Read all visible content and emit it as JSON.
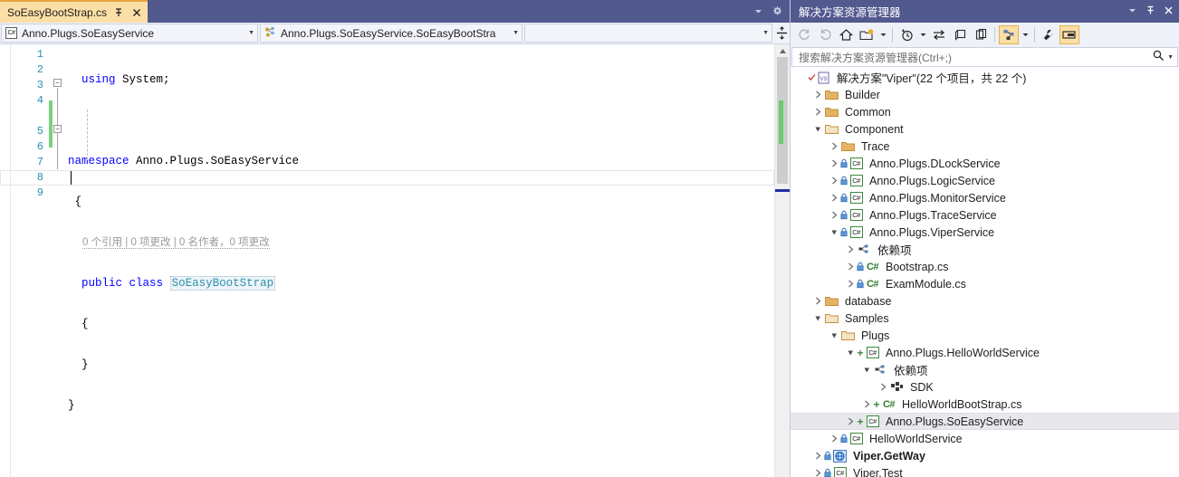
{
  "editor": {
    "tab": {
      "title": "SoEasyBootStrap.cs",
      "pin_icon": "pin-icon",
      "close_icon": "close-icon"
    },
    "tabstrip_right": {
      "dropdown_icon": "chevron-down-icon",
      "settings_icon": "gear-icon"
    },
    "navbar": {
      "project_combo": {
        "icon": "csharp-project-icon",
        "value": "Anno.Plugs.SoEasyService",
        "arrow": "chevron-down-icon"
      },
      "type_combo": {
        "icon": "class-members-icon",
        "value": "Anno.Plugs.SoEasyService.SoEasyBootStra",
        "arrow": "chevron-down-icon"
      },
      "member_combo": {
        "value": "",
        "arrow": "chevron-down-icon"
      },
      "split_icon": "split-view-icon"
    },
    "line_numbers": [
      "1",
      "2",
      "3",
      "4",
      "5",
      "6",
      "7",
      "8",
      "9"
    ],
    "codelens": "0 个引用 | 0 项更改 | 0 名作者，0 项更改",
    "code": {
      "l1_kw": "using",
      "l1_rest": " System;",
      "l3_kw": "namespace",
      "l3_rest": " Anno.Plugs.SoEasyService",
      "l4": "{",
      "l5_kw1": "public",
      "l5_kw2": "class",
      "l5_type": "SoEasyBootStrap",
      "l6": "{",
      "l7": "}",
      "l8": "}"
    },
    "scrollbar": {
      "up_icon": "scroll-up-icon",
      "down_icon": "scroll-down-icon"
    }
  },
  "solution_explorer": {
    "title": "解决方案资源管理器",
    "title_buttons": {
      "dropdown_icon": "chevron-down-icon",
      "pin_icon": "pin-icon",
      "close_icon": "close-icon"
    },
    "toolbar": [
      {
        "name": "back-button",
        "icon": "arrow-back-icon",
        "disabled": true,
        "active": false
      },
      {
        "name": "forward-button",
        "icon": "arrow-forward-icon",
        "disabled": true,
        "active": false
      },
      {
        "name": "home-button",
        "icon": "home-icon",
        "disabled": false,
        "active": false
      },
      {
        "name": "new-folder-button",
        "icon": "new-folder-icon",
        "disabled": false,
        "active": false
      },
      {
        "name": "new-folder-dropdown",
        "icon": "chevron-down-icon",
        "disabled": false,
        "active": false,
        "small": true
      },
      {
        "name": "pending-changes-button",
        "icon": "clock-icon",
        "disabled": false,
        "active": false
      },
      {
        "name": "pending-changes-dropdown",
        "icon": "chevron-down-icon",
        "disabled": false,
        "active": false,
        "small": true
      },
      {
        "name": "sync-with-active-document-button",
        "icon": "sync-arrows-icon",
        "disabled": false,
        "active": false
      },
      {
        "name": "refresh-button",
        "icon": "refresh-windows-icon",
        "disabled": false,
        "active": false
      },
      {
        "name": "collapse-all-button",
        "icon": "collapse-all-icon",
        "disabled": false,
        "active": false
      },
      {
        "name": "show-all-files-button",
        "icon": "show-all-files-icon",
        "disabled": false,
        "active": true
      },
      {
        "name": "show-all-files-dropdown",
        "icon": "chevron-down-icon",
        "disabled": false,
        "active": false,
        "small": true
      },
      {
        "name": "properties-button",
        "icon": "wrench-icon",
        "disabled": false,
        "active": false
      },
      {
        "name": "preview-pane-button",
        "icon": "preview-pane-icon",
        "disabled": false,
        "active": true
      }
    ],
    "search": {
      "placeholder": "搜索解决方案资源管理器(Ctrl+;)",
      "icon": "search-icon",
      "dropdown_icon": "chevron-down-icon"
    },
    "tree": [
      {
        "label": "解决方案\"Viper\"(22 个项目，共 22 个)",
        "depth": 0,
        "twist": "none",
        "icon": "solution-icon",
        "bold": false,
        "selected": false,
        "badge": "check"
      },
      {
        "label": "Builder",
        "depth": 1,
        "twist": "collapsed",
        "icon": "folder-icon",
        "bold": false,
        "selected": false,
        "badge": "none"
      },
      {
        "label": "Common",
        "depth": 1,
        "twist": "collapsed",
        "icon": "folder-icon",
        "bold": false,
        "selected": false,
        "badge": "none"
      },
      {
        "label": "Component",
        "depth": 1,
        "twist": "expanded",
        "icon": "folder-open-icon",
        "bold": false,
        "selected": false,
        "badge": "none"
      },
      {
        "label": "Trace",
        "depth": 2,
        "twist": "collapsed",
        "icon": "folder-icon",
        "bold": false,
        "selected": false,
        "badge": "none"
      },
      {
        "label": "Anno.Plugs.DLockService",
        "depth": 2,
        "twist": "collapsed",
        "icon": "csharp-project-icon",
        "bold": false,
        "selected": false,
        "badge": "lock"
      },
      {
        "label": "Anno.Plugs.LogicService",
        "depth": 2,
        "twist": "collapsed",
        "icon": "csharp-project-icon",
        "bold": false,
        "selected": false,
        "badge": "lock"
      },
      {
        "label": "Anno.Plugs.MonitorService",
        "depth": 2,
        "twist": "collapsed",
        "icon": "csharp-project-icon",
        "bold": false,
        "selected": false,
        "badge": "lock"
      },
      {
        "label": "Anno.Plugs.TraceService",
        "depth": 2,
        "twist": "collapsed",
        "icon": "csharp-project-icon",
        "bold": false,
        "selected": false,
        "badge": "lock"
      },
      {
        "label": "Anno.Plugs.ViperService",
        "depth": 2,
        "twist": "expanded",
        "icon": "csharp-project-icon",
        "bold": false,
        "selected": false,
        "badge": "lock"
      },
      {
        "label": "依赖项",
        "depth": 3,
        "twist": "collapsed",
        "icon": "dependencies-icon",
        "bold": false,
        "selected": false,
        "badge": "none"
      },
      {
        "label": "Bootstrap.cs",
        "depth": 3,
        "twist": "collapsed",
        "icon": "csharp-file-icon",
        "bold": false,
        "selected": false,
        "badge": "lock"
      },
      {
        "label": "ExamModule.cs",
        "depth": 3,
        "twist": "collapsed",
        "icon": "csharp-file-icon",
        "bold": false,
        "selected": false,
        "badge": "lock"
      },
      {
        "label": "database",
        "depth": 1,
        "twist": "collapsed",
        "icon": "folder-icon",
        "bold": false,
        "selected": false,
        "badge": "none"
      },
      {
        "label": "Samples",
        "depth": 1,
        "twist": "expanded",
        "icon": "folder-open-icon",
        "bold": false,
        "selected": false,
        "badge": "none"
      },
      {
        "label": "Plugs",
        "depth": 2,
        "twist": "expanded",
        "icon": "folder-open-icon",
        "bold": false,
        "selected": false,
        "badge": "none"
      },
      {
        "label": "Anno.Plugs.HelloWorldService",
        "depth": 3,
        "twist": "expanded",
        "icon": "csharp-project-icon",
        "bold": false,
        "selected": false,
        "badge": "plus"
      },
      {
        "label": "依赖项",
        "depth": 4,
        "twist": "expanded",
        "icon": "dependencies-icon",
        "bold": false,
        "selected": false,
        "badge": "none"
      },
      {
        "label": "SDK",
        "depth": 5,
        "twist": "collapsed",
        "icon": "sdk-icon",
        "bold": false,
        "selected": false,
        "badge": "none"
      },
      {
        "label": "HelloWorldBootStrap.cs",
        "depth": 4,
        "twist": "collapsed",
        "icon": "csharp-file-plain-icon",
        "bold": false,
        "selected": false,
        "badge": "plus"
      },
      {
        "label": "Anno.Plugs.SoEasyService",
        "depth": 3,
        "twist": "collapsed",
        "icon": "csharp-project-icon",
        "bold": false,
        "selected": true,
        "badge": "plus"
      },
      {
        "label": "HelloWorldService",
        "depth": 2,
        "twist": "collapsed",
        "icon": "csharp-project-icon",
        "bold": false,
        "selected": false,
        "badge": "lock"
      },
      {
        "label": "Viper.GetWay",
        "depth": 1,
        "twist": "collapsed",
        "icon": "web-project-icon",
        "bold": true,
        "selected": false,
        "badge": "lock"
      },
      {
        "label": "Viper.Test",
        "depth": 1,
        "twist": "collapsed",
        "icon": "csharp-project-icon",
        "bold": false,
        "selected": false,
        "badge": "lock"
      }
    ]
  }
}
